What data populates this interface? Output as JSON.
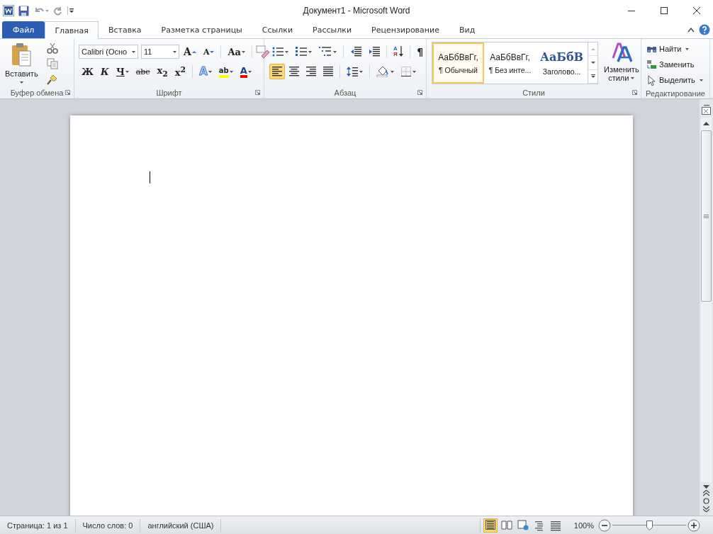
{
  "window": {
    "title": "Документ1 - Microsoft Word"
  },
  "tabs": [
    {
      "label": "Файл",
      "kind": "file",
      "selected": false
    },
    {
      "label": "Главная",
      "kind": "tab",
      "selected": true
    },
    {
      "label": "Вставка",
      "kind": "tab",
      "selected": false
    },
    {
      "label": "Разметка страницы",
      "kind": "tab",
      "selected": false
    },
    {
      "label": "Ссылки",
      "kind": "tab",
      "selected": false
    },
    {
      "label": "Рассылки",
      "kind": "tab",
      "selected": false
    },
    {
      "label": "Рецензирование",
      "kind": "tab",
      "selected": false
    },
    {
      "label": "Вид",
      "kind": "tab",
      "selected": false
    }
  ],
  "clipboard": {
    "paste": "Вставить",
    "label": "Буфер обмена"
  },
  "font": {
    "name": "Calibri (Осно",
    "size": "11",
    "size_buttons": [
      {
        "glyph": "A",
        "kind": "grow"
      },
      {
        "glyph": "A",
        "kind": "shrink"
      }
    ],
    "case_button": "Aa",
    "format_buttons": [
      {
        "glyph": "Ж",
        "kind": "bold"
      },
      {
        "glyph": "К",
        "kind": "italic"
      },
      {
        "glyph": "Ч",
        "kind": "underline"
      },
      {
        "glyph": "abc",
        "kind": "strike"
      },
      {
        "glyph": "x$_{2}$",
        "kind": "sub"
      },
      {
        "glyph": "x$^{2}$",
        "kind": "sup"
      }
    ],
    "effects": [
      {
        "glyph": "A",
        "kind": "text-effects"
      },
      {
        "glyph": "ab",
        "kind": "highlight",
        "color": "#ffff00"
      },
      {
        "glyph": "A",
        "kind": "font-color",
        "color": "#ff0000"
      }
    ],
    "label": "Шрифт"
  },
  "paragraph": {
    "sort": {
      "top": "А",
      "bottom": "Я"
    },
    "pilcrow": "¶",
    "align_buttons": [
      {
        "kind": "left",
        "selected": true
      },
      {
        "kind": "center",
        "selected": false
      },
      {
        "kind": "right",
        "selected": false
      },
      {
        "kind": "justify",
        "selected": false
      }
    ],
    "label": "Абзац"
  },
  "styles": {
    "items": [
      {
        "preview": "АаБбВвГг,",
        "name": "¶ Обычный",
        "kind": "normal",
        "selected": true
      },
      {
        "preview": "АаБбВвГг,",
        "name": "¶ Без инте...",
        "kind": "normal",
        "selected": false
      },
      {
        "preview": "АаБбВ",
        "name": "Заголово...",
        "kind": "heading",
        "selected": false
      }
    ],
    "change": [
      "Изменить",
      "стили"
    ],
    "label": "Стили"
  },
  "editing": {
    "items": [
      {
        "label": "Найти",
        "kind": "find",
        "dropdown": true
      },
      {
        "label": "Заменить",
        "kind": "replace",
        "dropdown": false
      },
      {
        "label": "Выделить",
        "kind": "select",
        "dropdown": true
      }
    ],
    "label": "Редактирование"
  },
  "status_bar": {
    "items": [
      "Страница: 1 из 1",
      "Число слов: 0",
      "английский (США)"
    ],
    "views": [
      {
        "kind": "print",
        "selected": true
      },
      {
        "kind": "read",
        "selected": false
      },
      {
        "kind": "web",
        "selected": false
      },
      {
        "kind": "outline",
        "selected": false
      },
      {
        "kind": "draft",
        "selected": false
      }
    ],
    "zoom": "100%",
    "zoom_slider": {
      "level": 0.5
    }
  }
}
